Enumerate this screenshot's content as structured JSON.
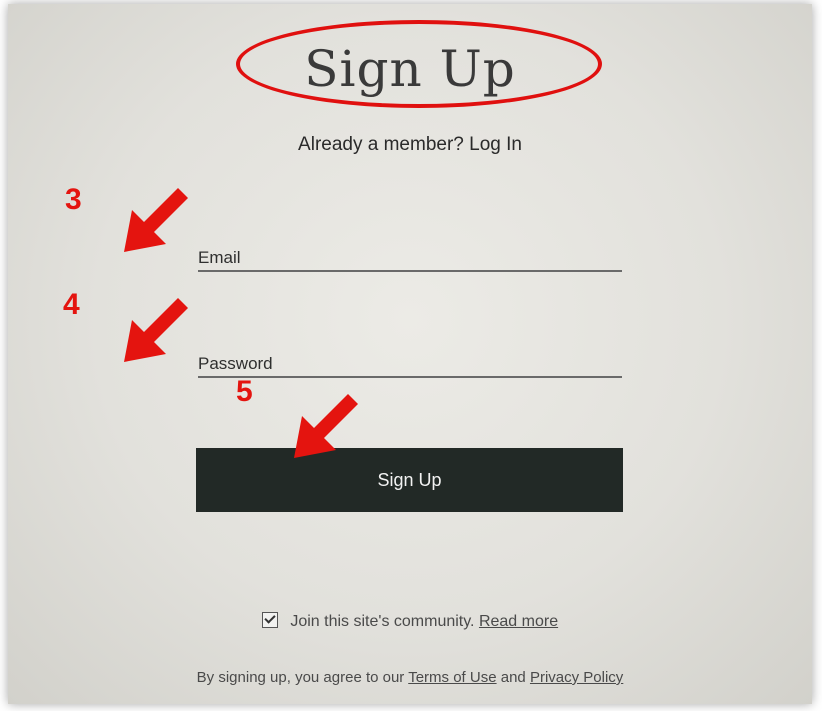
{
  "title": "Sign Up",
  "member_prefix": "Already a member?",
  "login_link": "Log In",
  "email_label": "Email",
  "password_label": "Password",
  "signup_button": "Sign Up",
  "community_text": "Join this site's community.",
  "read_more_link": "Read more",
  "agree_prefix": "By signing up, you agree to our",
  "terms_link": "Terms of Use",
  "agree_and": "and",
  "privacy_link": "Privacy Policy",
  "step_numbers": [
    "3",
    "4",
    "5"
  ],
  "annotation_color": "#e4140f",
  "button_color": "#222926",
  "community_checked": true
}
